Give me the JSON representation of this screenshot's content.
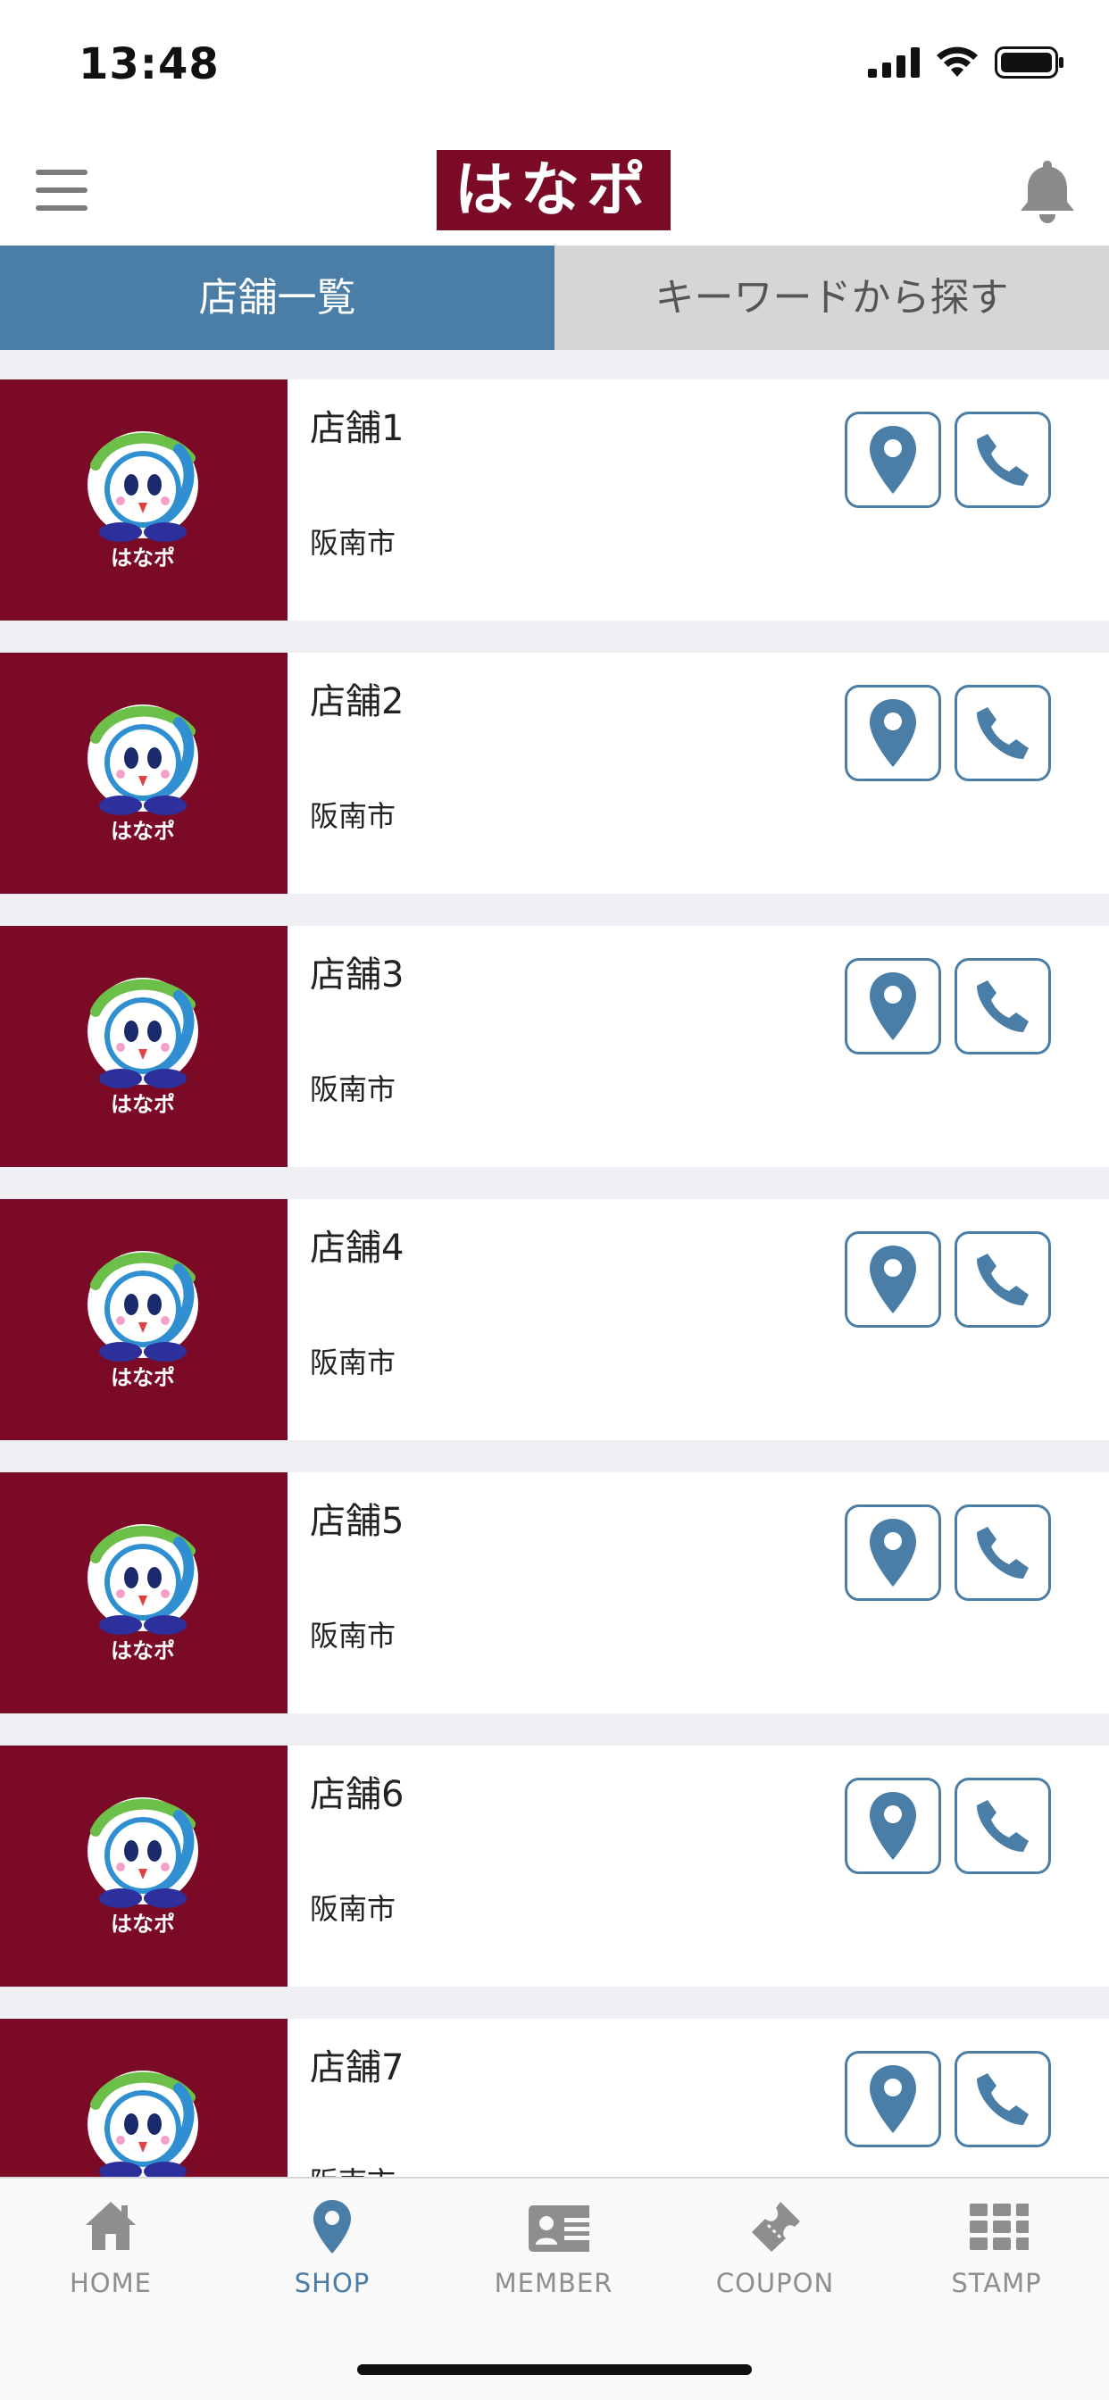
{
  "status_bar": {
    "time": "13:48"
  },
  "header": {
    "logo_text": "はなポ"
  },
  "tabs": [
    {
      "label": "店舗一覧",
      "active": true
    },
    {
      "label": "キーワードから探す",
      "active": false
    }
  ],
  "shops": [
    {
      "name": "店舗1",
      "area": "阪南市"
    },
    {
      "name": "店舗2",
      "area": "阪南市"
    },
    {
      "name": "店舗3",
      "area": "阪南市"
    },
    {
      "name": "店舗4",
      "area": "阪南市"
    },
    {
      "name": "店舗5",
      "area": "阪南市"
    },
    {
      "name": "店舗6",
      "area": "阪南市"
    },
    {
      "name": "店舗7",
      "area": "阪南市"
    }
  ],
  "mascot_label": "はなポ",
  "tab_bar": {
    "items": [
      {
        "label": "HOME",
        "icon": "home-icon",
        "active": false
      },
      {
        "label": "SHOP",
        "icon": "map-pin-icon",
        "active": true
      },
      {
        "label": "MEMBER",
        "icon": "member-card-icon",
        "active": false
      },
      {
        "label": "COUPON",
        "icon": "ticket-icon",
        "active": false
      },
      {
        "label": "STAMP",
        "icon": "grid-icon",
        "active": false
      }
    ]
  },
  "colors": {
    "brand": "#7a0a26",
    "accent": "#4a7ea6",
    "inactive_tab": "#d6d6d6",
    "separator": "#efeff4"
  }
}
